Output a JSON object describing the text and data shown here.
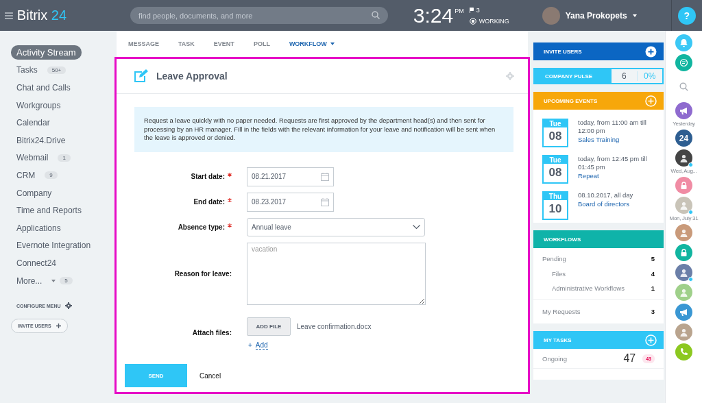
{
  "header": {
    "logo_main": "Bitrix",
    "logo_accent": "24",
    "search": {
      "placeholder": "find people, documents, and more"
    },
    "clock": {
      "time": "3:24",
      "ampm": "PM",
      "flags": "3",
      "status": "WORKING"
    },
    "user": {
      "name": "Yana Prokopets"
    },
    "help": "?"
  },
  "sidebar": {
    "items": [
      {
        "label": "Activity Stream",
        "selected": true
      },
      {
        "label": "Tasks",
        "counter": "50+",
        "selected": false
      },
      {
        "label": "Chat and Calls",
        "selected": false
      },
      {
        "label": "Workgroups",
        "selected": false
      },
      {
        "label": "Calendar",
        "selected": false
      },
      {
        "label": "Bitrix24.Drive",
        "selected": false
      },
      {
        "label": "Webmail",
        "counter": "1",
        "selected": false
      },
      {
        "label": "CRM",
        "counter": "9",
        "selected": false
      },
      {
        "label": "Company",
        "selected": false
      },
      {
        "label": "Time and Reports",
        "selected": false
      },
      {
        "label": "Applications",
        "selected": false
      },
      {
        "label": "Evernote Integration",
        "selected": false
      },
      {
        "label": "Connect24",
        "selected": false
      },
      {
        "label": "More...",
        "counter": "5",
        "dropdown": true,
        "selected": false
      }
    ],
    "configure": "CONFIGURE MENU",
    "invite": "INVITE USERS"
  },
  "tabs": [
    {
      "label": "MESSAGE",
      "selected": false
    },
    {
      "label": "TASK",
      "selected": false
    },
    {
      "label": "EVENT",
      "selected": false
    },
    {
      "label": "POLL",
      "selected": false
    },
    {
      "label": "WORKFLOW",
      "selected": true,
      "dropdown": true
    }
  ],
  "form": {
    "highlighted": true,
    "title": "Leave Approval",
    "info": "Request a leave quickly with no paper needed. Requests are first approved by the department head(s) and then sent for processing by an HR manager. Fill in the fields with the relevant information for your leave and notification will be sent when the leave is approved or denied.",
    "fields": [
      {
        "kind": "date",
        "label": "Start date:",
        "required": true,
        "value": "08.21.2017"
      },
      {
        "kind": "date",
        "label": "End date:",
        "required": true,
        "value": "08.23.2017"
      },
      {
        "kind": "select",
        "label": "Absence type:",
        "required": true,
        "value": "Annual leave"
      },
      {
        "kind": "textarea",
        "label": "Reason for leave:",
        "required": false,
        "placeholder": "vacation"
      },
      {
        "kind": "file",
        "label": "Attach files:",
        "required": false,
        "button": "ADD FILE",
        "file": "Leave confirmation.docx",
        "add_sign": "+",
        "add": "Add"
      }
    ],
    "send": "SEND",
    "cancel": "Cancel"
  },
  "right": {
    "invite": {
      "title": "INVITE USERS"
    },
    "pulse": {
      "title": "COMPANY PULSE",
      "count": "6",
      "percent": "0%"
    },
    "events": {
      "title": "UPCOMING EVENTS",
      "items": [
        {
          "day": "Tue",
          "date": "08",
          "time": "today, from 11:00 am till 12:00 pm",
          "name": "Sales Training"
        },
        {
          "day": "Tue",
          "date": "08",
          "time": "today, from 12:45 pm till 01:45 pm",
          "name": "Repeat"
        },
        {
          "day": "Thu",
          "date": "10",
          "time": "08.10.2017, all day",
          "name": "Board of directors"
        }
      ]
    },
    "workflows": {
      "title": "WORKFLOWS",
      "rows": [
        {
          "label": "Pending",
          "count": "5",
          "sub": false,
          "divider": false
        },
        {
          "label": "Files",
          "count": "4",
          "sub": true,
          "divider": false
        },
        {
          "label": "Administrative Workflows",
          "count": "1",
          "sub": true,
          "divider": true
        },
        {
          "label": "My Requests",
          "count": "3",
          "sub": false,
          "divider": false
        }
      ]
    },
    "tasks": {
      "title": "MY TASKS",
      "rows": [
        {
          "label": "Ongoing",
          "count": "47",
          "badge": "43"
        }
      ]
    }
  },
  "rail": {
    "items": [
      {
        "kind": "bell",
        "color": "#3bc8f5"
      },
      {
        "kind": "chat",
        "color": "#11b5a0"
      },
      {
        "kind": "search"
      },
      {
        "kind": "megaphone",
        "color": "#8f6bcf"
      },
      {
        "kind": "label",
        "text": "Yesterday"
      },
      {
        "kind": "logo",
        "color": "#2e5e91",
        "text": "24"
      },
      {
        "kind": "avatar",
        "color": "#444444",
        "online": true
      },
      {
        "kind": "label",
        "text": "Wed, Aug..."
      },
      {
        "kind": "lock",
        "color": "#f08ca4"
      },
      {
        "kind": "avatar",
        "color": "#c9c4b8",
        "online": true
      },
      {
        "kind": "label",
        "text": "Mon, July 31"
      },
      {
        "kind": "avatar",
        "color": "#c99a7a",
        "online": false
      },
      {
        "kind": "lock",
        "color": "#11b5a0"
      },
      {
        "kind": "avatar",
        "color": "#6b7fa8",
        "online": true
      },
      {
        "kind": "avatar",
        "color": "#9fd08a",
        "online": false
      },
      {
        "kind": "megaphone",
        "color": "#3a97d3"
      },
      {
        "kind": "avatar",
        "color": "#b9a48e",
        "online": false
      },
      {
        "kind": "phone",
        "color": "#8cc820"
      }
    ]
  }
}
